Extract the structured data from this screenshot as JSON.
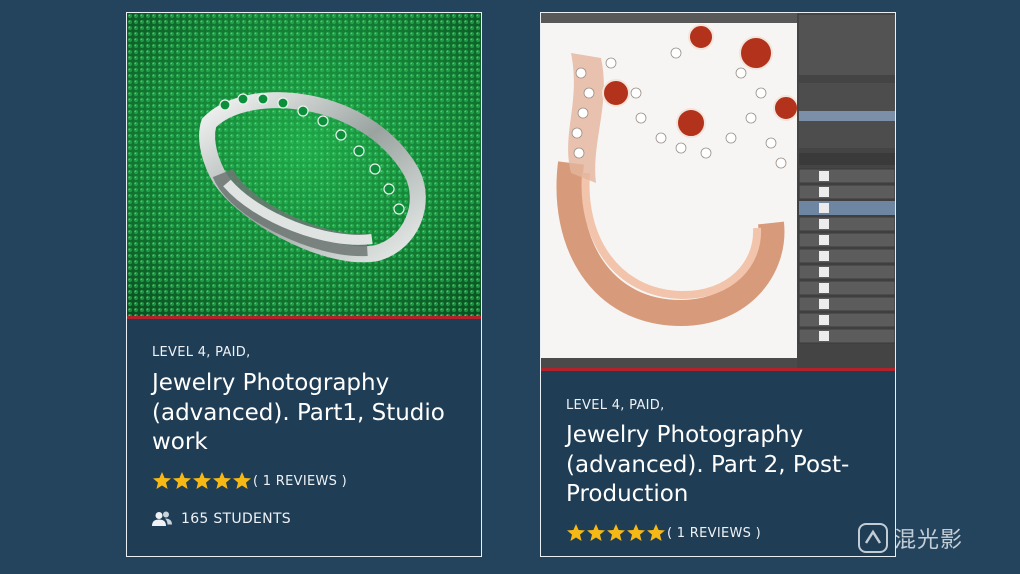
{
  "courses": [
    {
      "level": "LEVEL 4, PAID,",
      "title": "Jewelry Photography (advanced). Part1, Studio work",
      "rating": 5,
      "reviews": "( 1 REVIEWS )",
      "students": "165 STUDENTS",
      "image": "silver-ring-green-beads-photo"
    },
    {
      "level": "LEVEL 4, PAID,",
      "title": "Jewelry Photography (advanced). Part 2, Post-Production",
      "rating": 5,
      "reviews": "( 1 REVIEWS )",
      "image": "rose-gold-ring-photoshop-screenshot"
    }
  ],
  "watermark": {
    "text": "混光影"
  },
  "colors": {
    "background": "#24435c",
    "card": "#1f3d55",
    "accent_bar": "#b2222a",
    "star": "#f5b815"
  }
}
